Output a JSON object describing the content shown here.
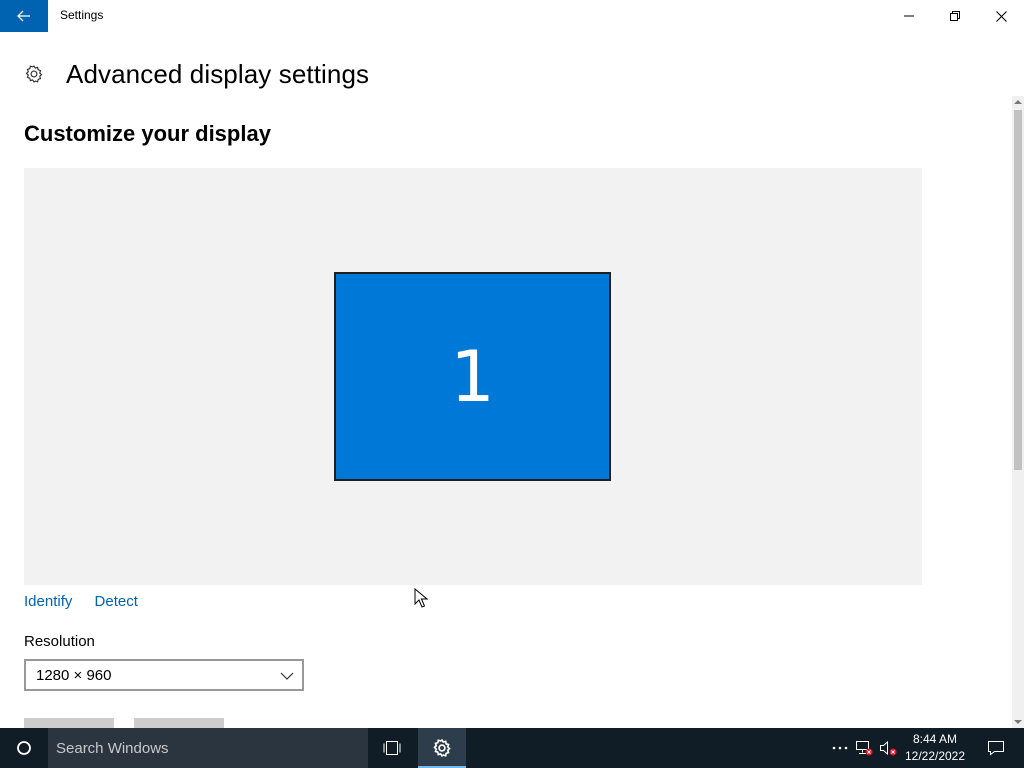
{
  "window": {
    "title": "Settings",
    "back_icon": "arrow-left-icon",
    "minimize_icon": "minimize-icon",
    "maximize_icon": "restore-icon",
    "close_icon": "close-icon"
  },
  "header": {
    "icon": "gear-icon",
    "title": "Advanced display settings"
  },
  "section": {
    "title": "Customize your display"
  },
  "preview": {
    "monitor_label": "1",
    "monitor_color": "#0078d7",
    "background": "#f2f2f2"
  },
  "links": {
    "identify": "Identify",
    "detect": "Detect"
  },
  "resolution": {
    "label": "Resolution",
    "selected": "1280 × 960"
  },
  "taskbar": {
    "search_placeholder": "Search Windows",
    "time": "8:44 AM",
    "date": "12/22/2022"
  },
  "colors": {
    "accent": "#0063b1",
    "taskbar": "#101c26"
  }
}
